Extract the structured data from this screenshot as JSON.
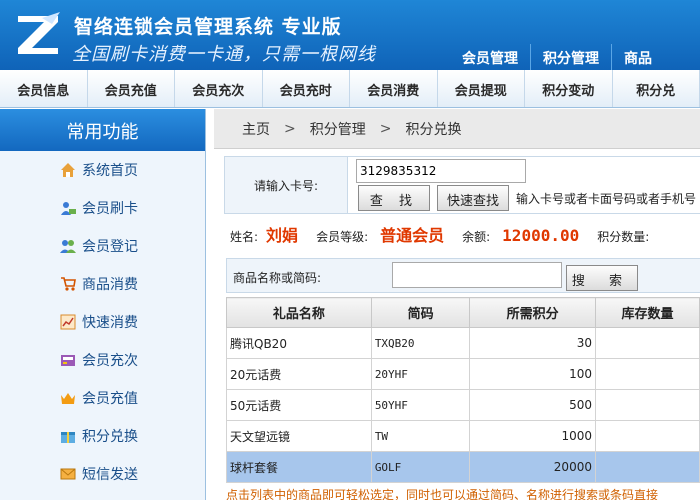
{
  "header": {
    "title": "智络连锁会员管理系统 专业版",
    "slogan": "全国刷卡消费一卡通，只需一根网线",
    "top_nav": [
      "会员管理",
      "积分管理",
      "商品"
    ]
  },
  "subnav": [
    "会员信息",
    "会员充值",
    "会员充次",
    "会员充时",
    "会员消费",
    "会员提现",
    "积分变动",
    "积分兑"
  ],
  "sidebar": {
    "heading": "常用功能",
    "items": [
      {
        "label": "系统首页",
        "icon": "home-icon"
      },
      {
        "label": "会员刷卡",
        "icon": "card-swipe-icon"
      },
      {
        "label": "会员登记",
        "icon": "users-icon"
      },
      {
        "label": "商品消费",
        "icon": "cart-icon"
      },
      {
        "label": "快速消费",
        "icon": "chart-icon"
      },
      {
        "label": "会员充次",
        "icon": "register-icon"
      },
      {
        "label": "会员充值",
        "icon": "crown-icon"
      },
      {
        "label": "积分兑换",
        "icon": "gift-icon"
      },
      {
        "label": "短信发送",
        "icon": "mail-icon"
      }
    ]
  },
  "breadcrumb": [
    "主页",
    "积分管理",
    "积分兑换"
  ],
  "card_form": {
    "label": "请输入卡号:",
    "card_value": "3129835312",
    "find_button": "查 找",
    "quick_find_button": "快速查找",
    "hint": "输入卡号或者卡面号码或者手机号"
  },
  "member": {
    "name_label": "姓名:",
    "name": "刘娟",
    "level_label": "会员等级:",
    "level": "普通会员",
    "balance_label": "余额:",
    "balance": "12000.00",
    "points_label": "积分数量:"
  },
  "search": {
    "label": "商品名称或简码:",
    "value": "",
    "button": "搜 索"
  },
  "table": {
    "headers": [
      "礼品名称",
      "简码",
      "所需积分",
      "库存数量"
    ],
    "rows": [
      {
        "name": "腾讯QB20",
        "code": "TXQB20",
        "points": "30",
        "stock": ""
      },
      {
        "name": "20元话费",
        "code": "20YHF",
        "points": "100",
        "stock": ""
      },
      {
        "name": "50元话费",
        "code": "50YHF",
        "points": "500",
        "stock": ""
      },
      {
        "name": "天文望远镜",
        "code": "TW",
        "points": "1000",
        "stock": ""
      },
      {
        "name": "球杆套餐",
        "code": "GOLF",
        "points": "20000",
        "stock": ""
      }
    ],
    "selected_row": 4
  },
  "footnote": "点击列表中的商品即可轻松选定，同时也可以通过简码、名称进行搜索或条码直接"
}
